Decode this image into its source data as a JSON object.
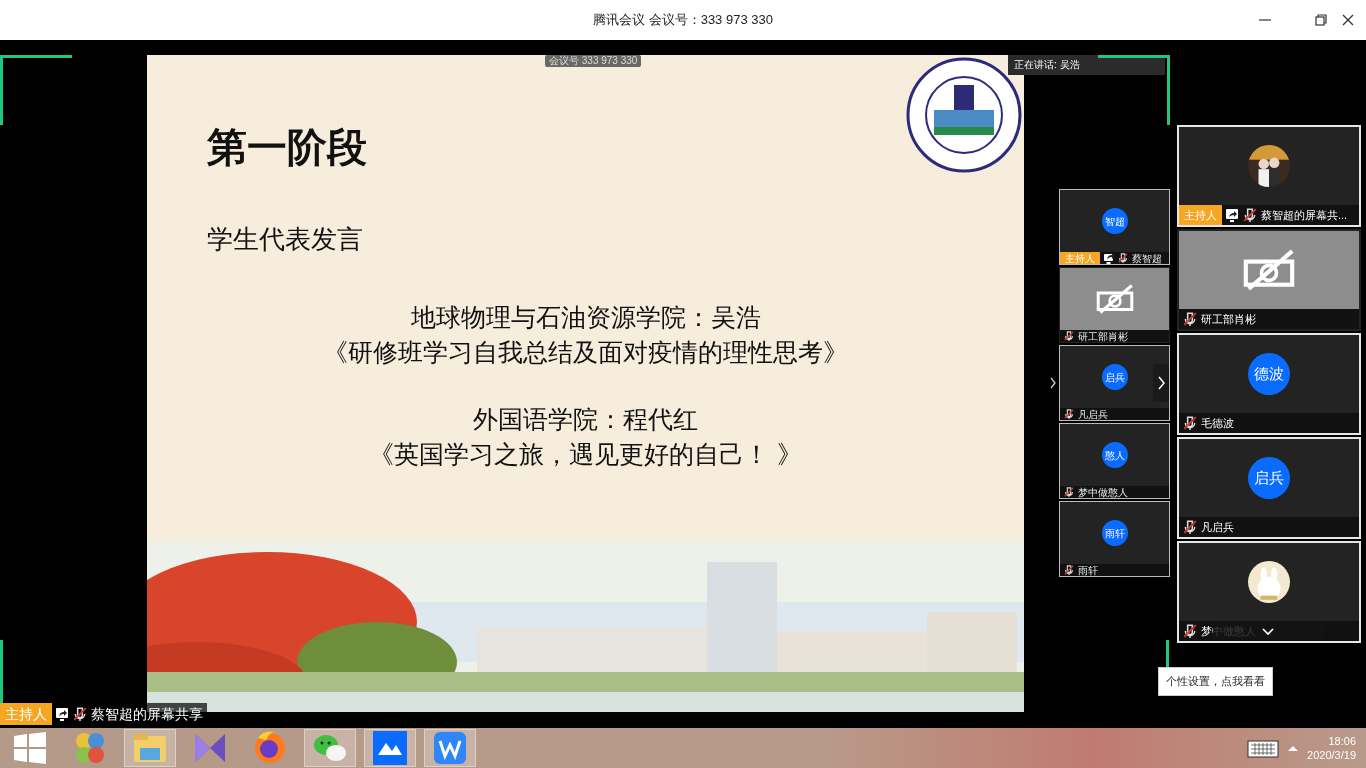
{
  "title_bar": {
    "title": "腾讯会议 会议号：333 973 330"
  },
  "meeting_pill": "会议号 333 973 330",
  "speaking": "正在讲话: 吴浩",
  "slide": {
    "title": "第一阶段",
    "subtitle": "学生代表发言",
    "lines": [
      "地球物理与石油资源学院：吴浩",
      "《研修班学习自我总结及面对疫情的理性思考》",
      "外国语学院：程代红",
      "《英国学习之旅，遇见更好的自己！ 》"
    ]
  },
  "share_label": {
    "host_badge": "主持人",
    "name": "蔡智超的屏幕共享",
    "muted": true
  },
  "mini_strip": [
    {
      "kind": "avatar",
      "initials": "智超",
      "host_badge": "主持人",
      "sharing": true,
      "muted": true,
      "name": "蔡智超"
    },
    {
      "kind": "camera_off",
      "muted": true,
      "name": "研工部肖彬"
    },
    {
      "kind": "avatar",
      "initials": "启兵",
      "muted": true,
      "name": "凡启兵"
    },
    {
      "kind": "avatar",
      "initials": "憨人",
      "muted": true,
      "name": "梦中做憨人"
    },
    {
      "kind": "avatar",
      "initials": "雨轩",
      "muted": true,
      "name": "雨轩"
    }
  ],
  "video_list": [
    {
      "host_badge": "主持人",
      "sharing": true,
      "muted": true,
      "name": "蔡智超的屏幕共..."
    },
    {
      "kind": "camera_off",
      "muted": true,
      "name": "研工部肖彬"
    },
    {
      "kind": "avatar",
      "initials": "德波",
      "muted": true,
      "name": "毛德波"
    },
    {
      "kind": "avatar",
      "initials": "启兵",
      "muted": true,
      "name": "凡启兵"
    },
    {
      "muted": true,
      "name": "梦中做憨人"
    }
  ],
  "tooltip": "个性设置，点我看看",
  "taskbar": {
    "apps": [
      {
        "kind": "start",
        "selected": false
      },
      {
        "kind": "balls",
        "selected": false
      },
      {
        "kind": "folder",
        "selected": true
      },
      {
        "kind": "bowtie",
        "selected": false
      },
      {
        "kind": "browser",
        "selected": false
      },
      {
        "kind": "chat",
        "selected": true
      },
      {
        "kind": "meeting",
        "selected": true
      },
      {
        "kind": "wps",
        "selected": true
      }
    ],
    "clock": {
      "time": "18:06",
      "date": "2020/3/19"
    }
  }
}
